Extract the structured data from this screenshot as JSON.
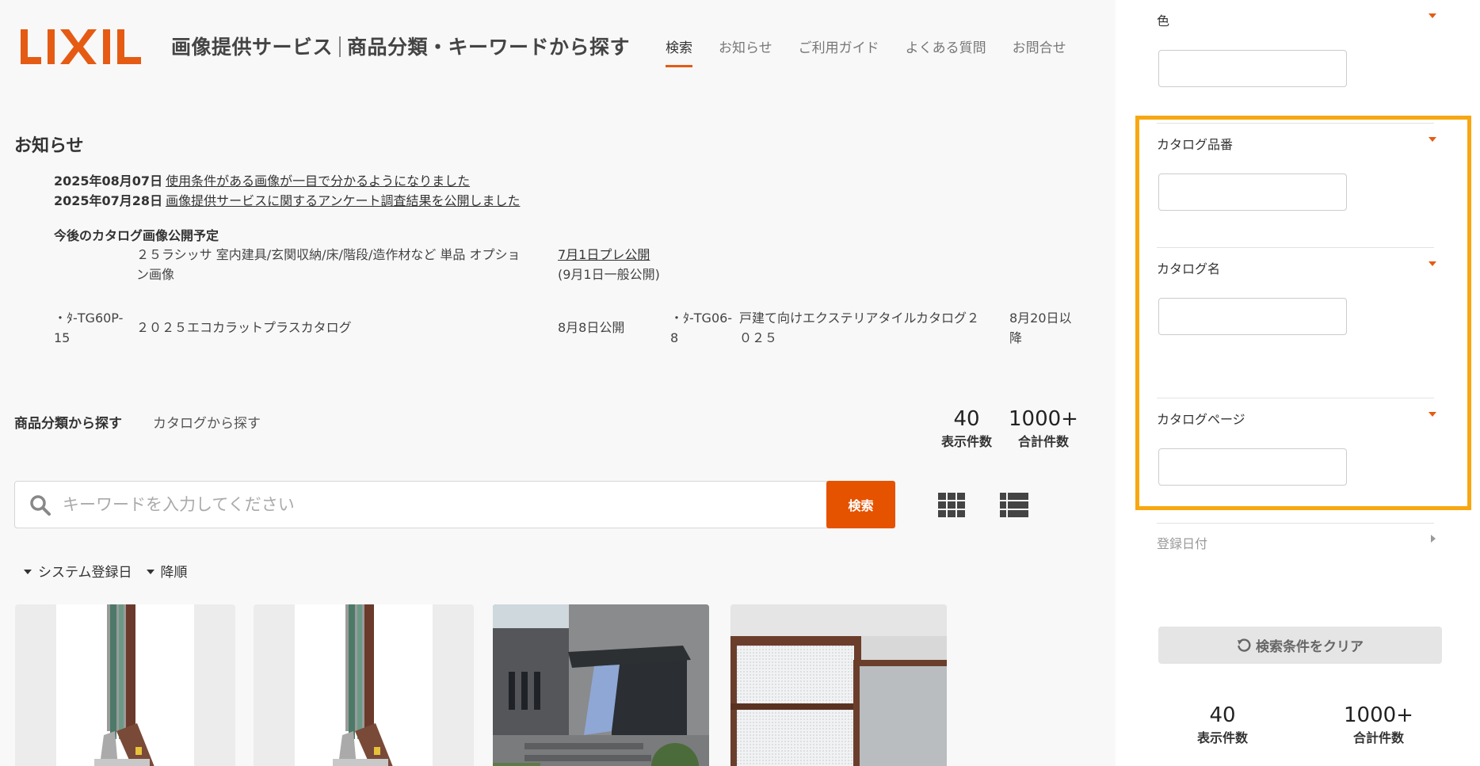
{
  "header": {
    "logo_text": "LIXIL",
    "title_left": "画像提供サービス",
    "title_right": "商品分類・キーワードから探す",
    "nav": [
      "検索",
      "お知らせ",
      "ご利用ガイド",
      "よくある質問",
      "お問合せ"
    ],
    "active_nav": "検索",
    "brand_color": "#e55b13"
  },
  "news": {
    "heading": "お知らせ",
    "items": [
      {
        "date": "2025年08月07日",
        "text": "使用条件がある画像が一目で分かるようになりました"
      },
      {
        "date": "2025年07月28日",
        "text": "画像提供サービスに関するアンケート調査結果を公開しました"
      }
    ],
    "schedule_heading": "今後のカタログ画像公開予定",
    "schedule": [
      {
        "code": "",
        "name_line1": "２５ラシッサ 室内建具/玄関収納/床/階段/造作材など 単品 オプショ",
        "name_line2": "ン画像",
        "status_link": "7月1日プレ公開",
        "status_note": "(9月1日一般公開)"
      },
      {
        "code_line1": "・ﾀ-TG60P-",
        "code_line2": "15",
        "name": "２０２５エコカラットプラスカタログ",
        "status": "8月8日公開"
      },
      {
        "code_line1": "・ﾀ-TG06-",
        "code_line2": "8",
        "name_line1": "戸建て向けエクステリアタイルカタログ２",
        "name_line2": "０２５",
        "status_line1": "8月20日以",
        "status_line2": "降"
      }
    ]
  },
  "search": {
    "tab_category": "商品分類から探す",
    "tab_catalog": "カタログから探す",
    "display_count": "40",
    "display_count_label": "表示件数",
    "total_count": "1000+",
    "total_count_label": "合計件数",
    "placeholder": "キーワードを入力してください",
    "button_label": "検索",
    "sort_field": "システム登録日",
    "sort_order": "降順"
  },
  "sidebar": {
    "color_label": "色",
    "catalog_number_label": "カタログ品番",
    "catalog_name_label": "カタログ名",
    "catalog_page_label": "カタログページ",
    "register_date_label": "登録日付",
    "clear_button": "検索条件をクリア",
    "display_count": "40",
    "display_count_label": "表示件数",
    "total_count": "1000+",
    "total_count_label": "合計件数",
    "highlight_color": "#f7a711"
  }
}
